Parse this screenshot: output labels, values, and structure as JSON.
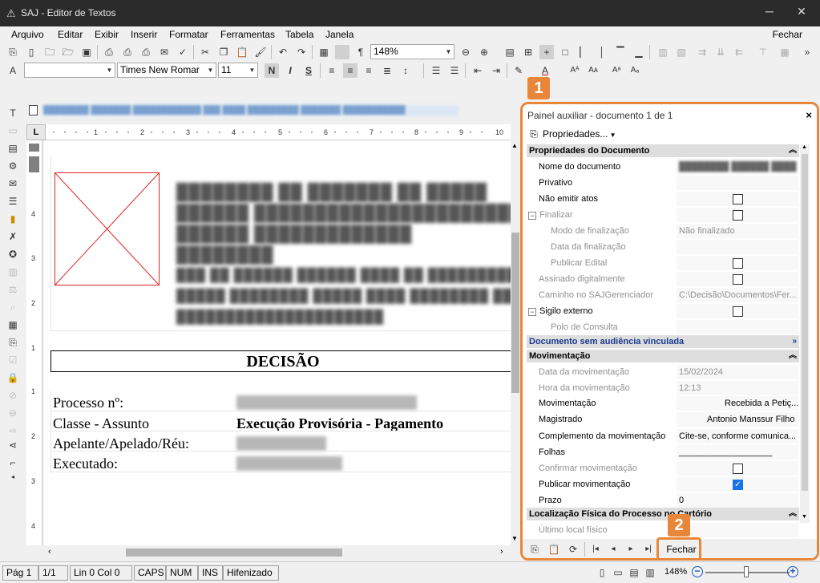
{
  "window": {
    "title": "SAJ - Editor de Textos",
    "minimize_glyph": "─",
    "close_glyph": "✕"
  },
  "menu": {
    "items": [
      "Arquivo",
      "Editar",
      "Exibir",
      "Inserir",
      "Formatar",
      "Ferramentas",
      "Tabela",
      "Janela"
    ],
    "close_label": "Fechar"
  },
  "toolbar": {
    "zoom_value": "148%",
    "font_name": "Times New Romar",
    "font_size": "11",
    "bold_label": "N",
    "italic_label": "I",
    "strike_label": "S",
    "pilcrow": "¶"
  },
  "document": {
    "decisao": "DECISÃO",
    "fields": [
      {
        "label": "Processo nº:",
        "value": ""
      },
      {
        "label": "Classe - Assunto",
        "value": "Execução Provisória - Pagamento"
      },
      {
        "label": "Apelante/Apelado/Réu:",
        "value": ""
      },
      {
        "label": "Executado:",
        "value": ""
      }
    ]
  },
  "panel": {
    "title": "Painel auxiliar - documento 1 de 1",
    "close_glyph": "×",
    "properties_button": "Propriedades...",
    "sections": {
      "doc_props": "Propriedades do Documento",
      "audiencia": "Documento sem audiência vinculada",
      "movimentacao": "Movimentação",
      "localizacao": "Localização Física do Processo no Cartório"
    },
    "rows": {
      "nome_documento": "Nome do documento",
      "privativo": "Privativo",
      "nao_emitir_atos": "Não emitir atos",
      "finalizar": "Finalizar",
      "modo_finalizacao": "Modo de finalização",
      "modo_finalizacao_value": "Não finalizado",
      "data_finalizacao": "Data da finalização",
      "publicar_edital": "Publicar Edital",
      "assinado_digitalmente": "Assinado digitalmente",
      "caminho_sajgerenciador": "Caminho no SAJGerenciador",
      "caminho_value": "C:\\Decisão\\Documentos\\Fer...",
      "sigilo_externo": "Sigilo externo",
      "polo_consulta": "Polo de Consulta",
      "data_movimentacao": "Data da movimentação",
      "data_movimentacao_value": "15/02/2024",
      "hora_movimentacao": "Hora da movimentação",
      "hora_movimentacao_value": "12:13",
      "movimentacao": "Movimentação",
      "movimentacao_value": "Recebida a Petiç...",
      "magistrado": "Magistrado",
      "magistrado_value": "Antonio Manssur Filho",
      "complemento": "Complemento da movimentação",
      "complemento_value": "Cite-se, conforme comunica...",
      "folhas": "Folhas",
      "folhas_value": "___________________",
      "confirmar_movimentacao": "Confirmar movimentação",
      "publicar_movimentacao": "Publicar movimentação",
      "prazo": "Prazo",
      "prazo_value": "0",
      "ultimo_local": "Último local físico"
    },
    "footer_close": "Fechar"
  },
  "badges": {
    "one": "1",
    "two": "2"
  },
  "status": {
    "page": "Pág 1",
    "pages": "1/1",
    "line_col": "Lin 0  Col 0",
    "caps": "CAPS",
    "num": "NUM",
    "ins": "INS",
    "hyph": "Hifenizado",
    "zoom": "148%"
  },
  "colors": {
    "accent": "#e8873a",
    "titlebar": "#2b2b2b",
    "section_blue": "#1a3b8f",
    "check_blue": "#1a73e8"
  }
}
